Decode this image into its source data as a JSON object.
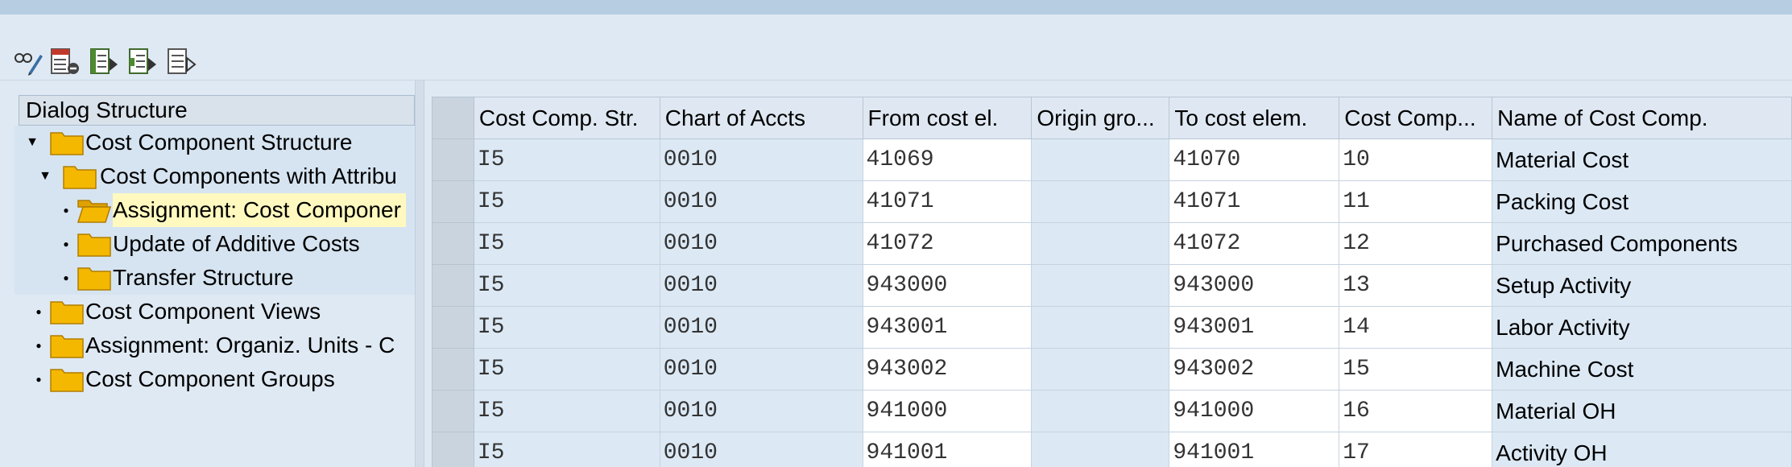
{
  "toolbar": {
    "icons": [
      "display-change-icon",
      "delete-row-icon",
      "select-all-icon",
      "select-block-icon",
      "deselect-all-icon"
    ]
  },
  "dialog": {
    "header": "Dialog Structure",
    "items": [
      {
        "label": "Cost Component Structure",
        "toggle": "expanded"
      },
      {
        "label": "Cost Components with Attribu",
        "toggle": "expanded"
      },
      {
        "label": "Assignment: Cost Componer",
        "toggle": "bullet",
        "selected": true
      },
      {
        "label": "Update of Additive Costs",
        "toggle": "bullet"
      },
      {
        "label": "Transfer Structure",
        "toggle": "bullet"
      },
      {
        "label": "Cost Component Views",
        "toggle": "bullet"
      },
      {
        "label": "Assignment: Organiz. Units - C",
        "toggle": "bullet"
      },
      {
        "label": "Cost Component Groups",
        "toggle": "bullet"
      }
    ]
  },
  "grid": {
    "columns": [
      "Cost Comp. Str.",
      "Chart of Accts",
      "From cost el.",
      "Origin gro...",
      "To cost elem.",
      "Cost Comp...",
      "Name of Cost Comp."
    ],
    "rows": [
      [
        "I5",
        "0010",
        "41069",
        "",
        "41070",
        "10",
        "Material Cost"
      ],
      [
        "I5",
        "0010",
        "41071",
        "",
        "41071",
        "11",
        "Packing Cost"
      ],
      [
        "I5",
        "0010",
        "41072",
        "",
        "41072",
        "12",
        "Purchased Components"
      ],
      [
        "I5",
        "0010",
        "943000",
        "",
        "943000",
        "13",
        "Setup Activity"
      ],
      [
        "I5",
        "0010",
        "943001",
        "",
        "943001",
        "14",
        "Labor Activity"
      ],
      [
        "I5",
        "0010",
        "943002",
        "",
        "943002",
        "15",
        "Machine Cost"
      ],
      [
        "I5",
        "0010",
        "941000",
        "",
        "941000",
        "16",
        "Material OH"
      ],
      [
        "I5",
        "0010",
        "941001",
        "",
        "941001",
        "17",
        "Activity OH"
      ]
    ]
  },
  "colors": {
    "folder": "#f5b800",
    "folder_edge": "#b07d00",
    "selected_highlight": "#fff9bf",
    "cell_readonly": "#dce9f5"
  }
}
